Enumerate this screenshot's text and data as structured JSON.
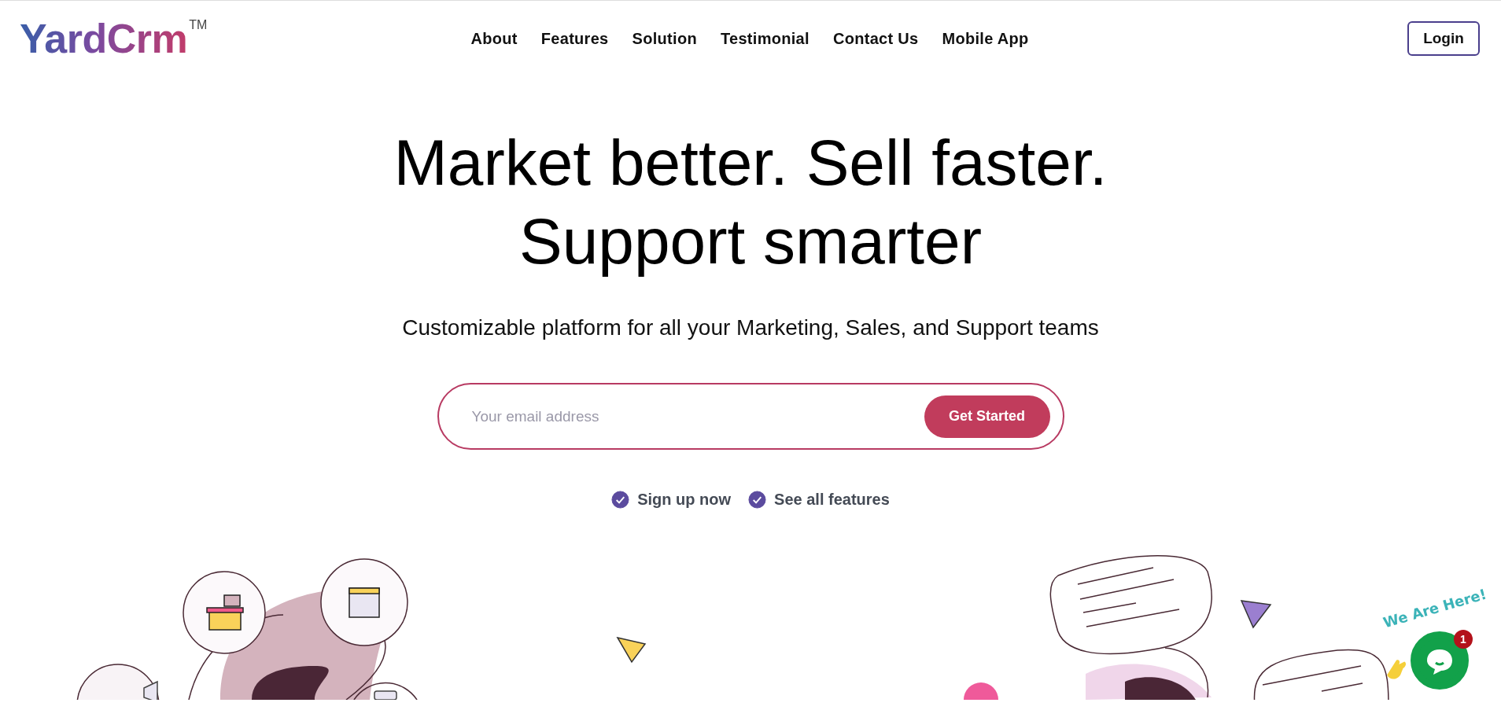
{
  "header": {
    "logo": "YardCrm",
    "trademark": "TM",
    "nav": [
      "About",
      "Features",
      "Solution",
      "Testimonial",
      "Contact Us",
      "Mobile App"
    ],
    "login": "Login"
  },
  "hero": {
    "title_lines": [
      "Market better. Sell faster.",
      "Support smarter"
    ],
    "subtitle": "Customizable platform for all your Marketing, Sales, and Support teams",
    "email": {
      "placeholder": "Your email address"
    },
    "cta": "Get Started",
    "checks": [
      {
        "label": "Sign up now",
        "checked": true
      },
      {
        "label": "See all features",
        "checked": true
      }
    ]
  },
  "chat_widget": {
    "greeting": "We Are Here!",
    "badge": "1"
  }
}
